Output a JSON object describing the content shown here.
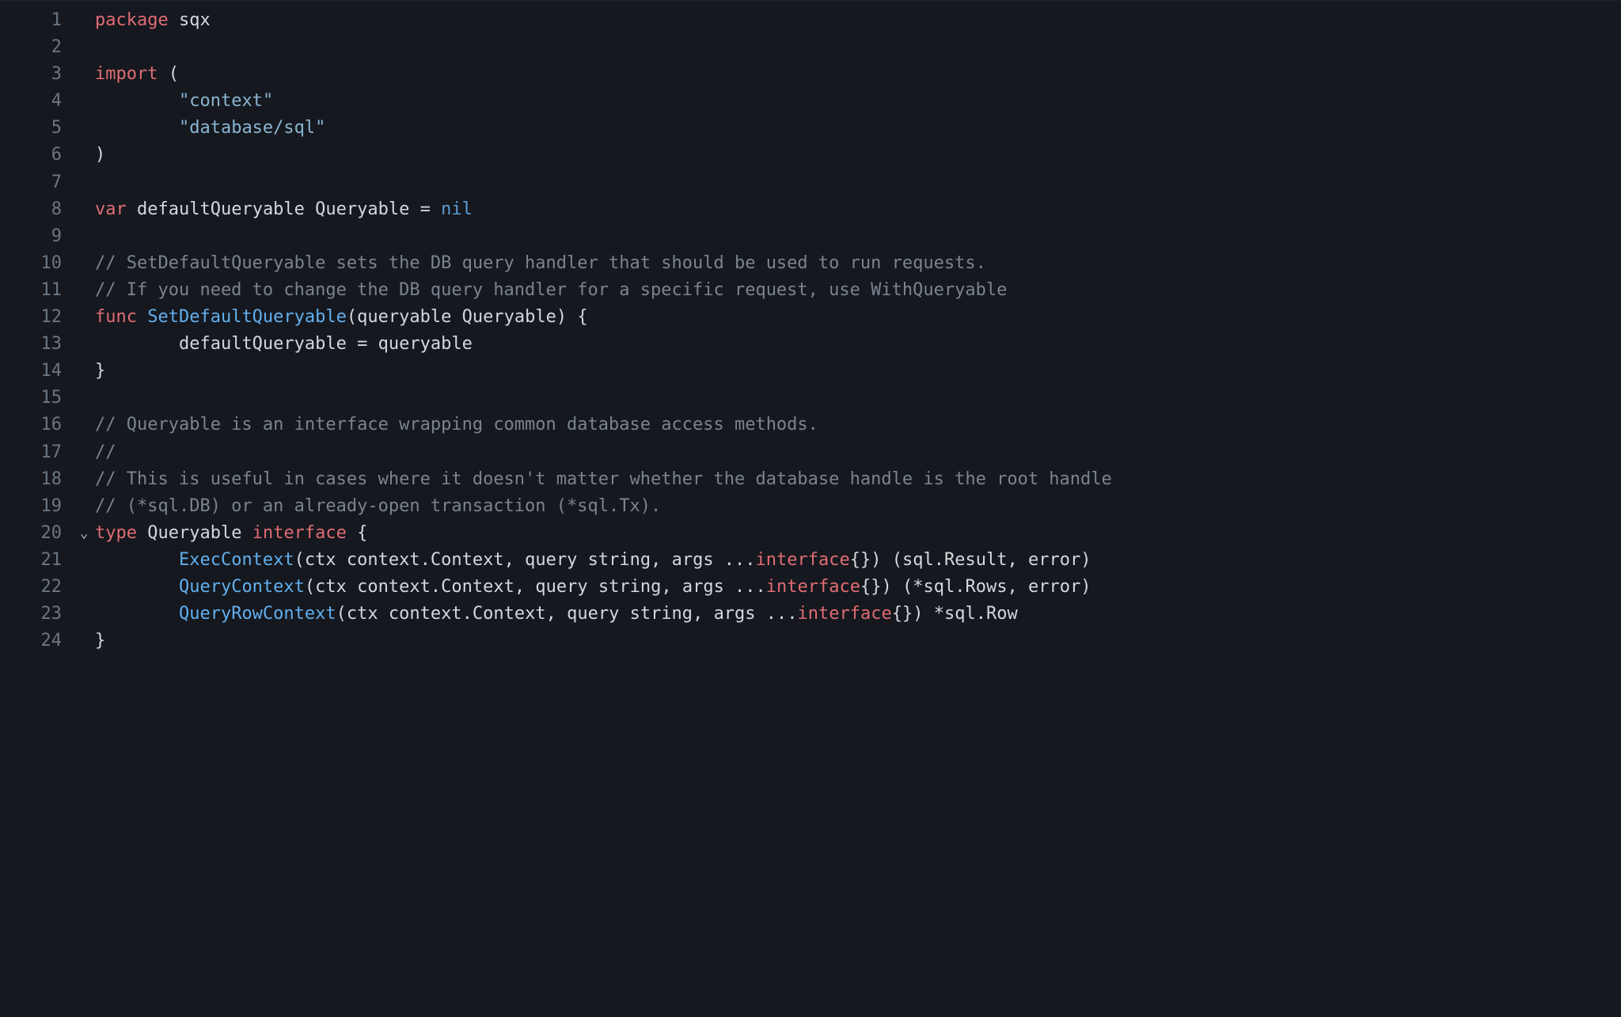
{
  "editor": {
    "line_count": 24,
    "fold_line": 20,
    "fold_glyph": "⌄",
    "lines": [
      {
        "n": 1,
        "tokens": [
          [
            "t-kw",
            "package"
          ],
          [
            "",
            " "
          ],
          [
            "t-ident",
            "sqx"
          ]
        ]
      },
      {
        "n": 2,
        "tokens": [
          [
            "",
            ""
          ]
        ]
      },
      {
        "n": 3,
        "tokens": [
          [
            "t-kw",
            "import"
          ],
          [
            "",
            " ("
          ]
        ]
      },
      {
        "n": 4,
        "tokens": [
          [
            "",
            "        "
          ],
          [
            "t-str",
            "\"context\""
          ]
        ]
      },
      {
        "n": 5,
        "tokens": [
          [
            "",
            "        "
          ],
          [
            "t-str",
            "\"database/sql\""
          ]
        ]
      },
      {
        "n": 6,
        "tokens": [
          [
            "",
            ")"
          ]
        ]
      },
      {
        "n": 7,
        "tokens": [
          [
            "",
            ""
          ]
        ]
      },
      {
        "n": 8,
        "tokens": [
          [
            "t-kw",
            "var"
          ],
          [
            "",
            " "
          ],
          [
            "t-ident",
            "defaultQueryable"
          ],
          [
            "",
            " "
          ],
          [
            "t-ident",
            "Queryable"
          ],
          [
            "",
            " "
          ],
          [
            "t-op",
            "="
          ],
          [
            "",
            " "
          ],
          [
            "t-nil",
            "nil"
          ]
        ]
      },
      {
        "n": 9,
        "tokens": [
          [
            "",
            ""
          ]
        ]
      },
      {
        "n": 10,
        "tokens": [
          [
            "t-comment",
            "// SetDefaultQueryable sets the DB query handler that should be used to run requests."
          ]
        ]
      },
      {
        "n": 11,
        "tokens": [
          [
            "t-comment",
            "// If you need to change the DB query handler for a specific request, use WithQueryable"
          ]
        ]
      },
      {
        "n": 12,
        "tokens": [
          [
            "t-kw",
            "func"
          ],
          [
            "",
            " "
          ],
          [
            "t-func",
            "SetDefaultQueryable"
          ],
          [
            "",
            "("
          ],
          [
            "t-ident",
            "queryable"
          ],
          [
            "",
            " "
          ],
          [
            "t-ident",
            "Queryable"
          ],
          [
            "",
            ") {"
          ]
        ]
      },
      {
        "n": 13,
        "tokens": [
          [
            "",
            "        "
          ],
          [
            "t-ident",
            "defaultQueryable"
          ],
          [
            "",
            " "
          ],
          [
            "t-op",
            "="
          ],
          [
            "",
            " "
          ],
          [
            "t-ident",
            "queryable"
          ]
        ]
      },
      {
        "n": 14,
        "tokens": [
          [
            "",
            "}"
          ]
        ]
      },
      {
        "n": 15,
        "tokens": [
          [
            "",
            ""
          ]
        ]
      },
      {
        "n": 16,
        "tokens": [
          [
            "t-comment",
            "// Queryable is an interface wrapping common database access methods."
          ]
        ]
      },
      {
        "n": 17,
        "tokens": [
          [
            "t-comment",
            "//"
          ]
        ]
      },
      {
        "n": 18,
        "tokens": [
          [
            "t-comment",
            "// This is useful in cases where it doesn't matter whether the database handle is the root handle"
          ]
        ]
      },
      {
        "n": 19,
        "tokens": [
          [
            "t-comment",
            "// (*sql.DB) or an already-open transaction (*sql.Tx)."
          ]
        ]
      },
      {
        "n": 20,
        "tokens": [
          [
            "t-kw",
            "type"
          ],
          [
            "",
            " "
          ],
          [
            "t-ident",
            "Queryable"
          ],
          [
            "",
            " "
          ],
          [
            "t-kw",
            "interface"
          ],
          [
            "",
            " {"
          ]
        ]
      },
      {
        "n": 21,
        "tokens": [
          [
            "",
            "        "
          ],
          [
            "t-call",
            "ExecContext"
          ],
          [
            "",
            "("
          ],
          [
            "t-ident",
            "ctx"
          ],
          [
            "",
            " "
          ],
          [
            "t-ident",
            "context"
          ],
          [
            "",
            "."
          ],
          [
            "t-ident",
            "Context"
          ],
          [
            "",
            ", "
          ],
          [
            "t-ident",
            "query"
          ],
          [
            "",
            " "
          ],
          [
            "t-ident",
            "string"
          ],
          [
            "",
            ", "
          ],
          [
            "t-ident",
            "args"
          ],
          [
            "",
            " ..."
          ],
          [
            "t-kw2",
            "interface"
          ],
          [
            "",
            "{}) ("
          ],
          [
            "t-ident",
            "sql"
          ],
          [
            "",
            "."
          ],
          [
            "t-ident",
            "Result"
          ],
          [
            "",
            ", "
          ],
          [
            "t-ident",
            "error"
          ],
          [
            "",
            ")"
          ]
        ]
      },
      {
        "n": 22,
        "tokens": [
          [
            "",
            "        "
          ],
          [
            "t-call",
            "QueryContext"
          ],
          [
            "",
            "("
          ],
          [
            "t-ident",
            "ctx"
          ],
          [
            "",
            " "
          ],
          [
            "t-ident",
            "context"
          ],
          [
            "",
            "."
          ],
          [
            "t-ident",
            "Context"
          ],
          [
            "",
            ", "
          ],
          [
            "t-ident",
            "query"
          ],
          [
            "",
            " "
          ],
          [
            "t-ident",
            "string"
          ],
          [
            "",
            ", "
          ],
          [
            "t-ident",
            "args"
          ],
          [
            "",
            " ..."
          ],
          [
            "t-kw2",
            "interface"
          ],
          [
            "",
            "{}) ("
          ],
          [
            "t-op",
            "*"
          ],
          [
            "t-ident",
            "sql"
          ],
          [
            "",
            "."
          ],
          [
            "t-ident",
            "Rows"
          ],
          [
            "",
            ", "
          ],
          [
            "t-ident",
            "error"
          ],
          [
            "",
            ")"
          ]
        ]
      },
      {
        "n": 23,
        "tokens": [
          [
            "",
            "        "
          ],
          [
            "t-call",
            "QueryRowContext"
          ],
          [
            "",
            "("
          ],
          [
            "t-ident",
            "ctx"
          ],
          [
            "",
            " "
          ],
          [
            "t-ident",
            "context"
          ],
          [
            "",
            "."
          ],
          [
            "t-ident",
            "Context"
          ],
          [
            "",
            ", "
          ],
          [
            "t-ident",
            "query"
          ],
          [
            "",
            " "
          ],
          [
            "t-ident",
            "string"
          ],
          [
            "",
            ", "
          ],
          [
            "t-ident",
            "args"
          ],
          [
            "",
            " ..."
          ],
          [
            "t-kw2",
            "interface"
          ],
          [
            "",
            "{}) "
          ],
          [
            "t-op",
            "*"
          ],
          [
            "t-ident",
            "sql"
          ],
          [
            "",
            "."
          ],
          [
            "t-ident",
            "Row"
          ]
        ]
      },
      {
        "n": 24,
        "tokens": [
          [
            "",
            "}"
          ]
        ]
      }
    ]
  }
}
